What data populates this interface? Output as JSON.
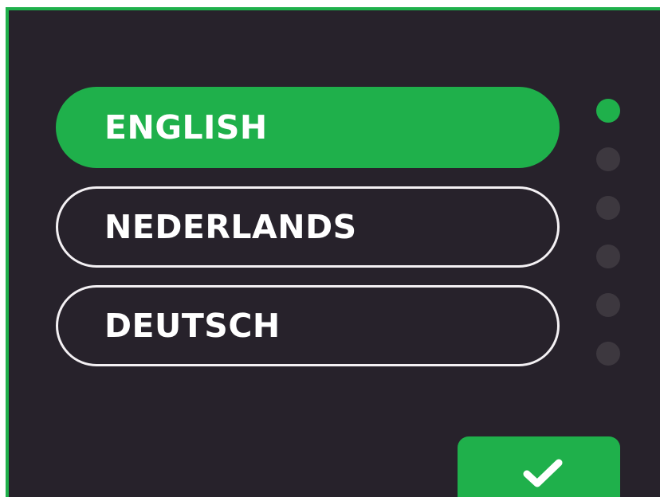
{
  "language_list": {
    "options": [
      {
        "label": "ENGLISH",
        "selected": true
      },
      {
        "label": "NEDERLANDS",
        "selected": false
      },
      {
        "label": "DEUTSCH",
        "selected": false
      }
    ]
  },
  "pager": {
    "total_dots": 6,
    "active_index": 0
  },
  "confirm_button": {
    "icon": "check-icon"
  },
  "colors": {
    "accent": "#1fb04b",
    "background": "#27222b",
    "outline": "#f4f1f4",
    "inactive_dot": "#3d383f",
    "text": "#ffffff"
  }
}
